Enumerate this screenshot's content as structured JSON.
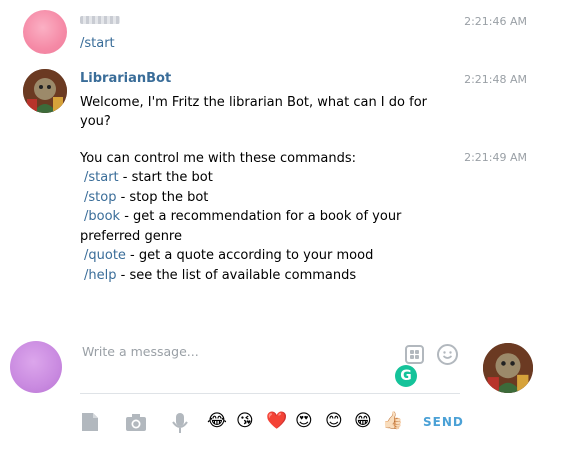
{
  "messages": [
    {
      "sender": "",
      "time": "2:21:46 AM",
      "text": "/start"
    },
    {
      "sender": "LibrarianBot",
      "time": "2:21:48 AM",
      "lines": [
        "Welcome, I'm Fritz the librarian Bot, what can I do for",
        "you?"
      ]
    },
    {
      "sender": "LibrarianBot",
      "time": "2:21:49 AM",
      "intro": "You can control me with these commands:",
      "commands": [
        {
          "cmd": "/start",
          "desc": " - start the bot"
        },
        {
          "cmd": "/stop",
          "desc": " - stop the bot"
        },
        {
          "cmd": "/book",
          "desc": " - get a recommendation for a book of your"
        },
        {
          "cmd": "",
          "desc": "preferred genre"
        },
        {
          "cmd": "/quote",
          "desc": " - get a quote according to your mood"
        },
        {
          "cmd": "/help",
          "desc": " - see the list of available commands"
        }
      ]
    }
  ],
  "composer": {
    "placeholder": "Write a message...",
    "send_label": "SEND",
    "emojis": [
      "😂",
      "😘",
      "❤️",
      "😍",
      "😊",
      "😁",
      "👍🏻"
    ]
  },
  "colors": {
    "link": "#3a6d99",
    "send": "#4ba1d6",
    "muted": "#9aa0a6"
  }
}
